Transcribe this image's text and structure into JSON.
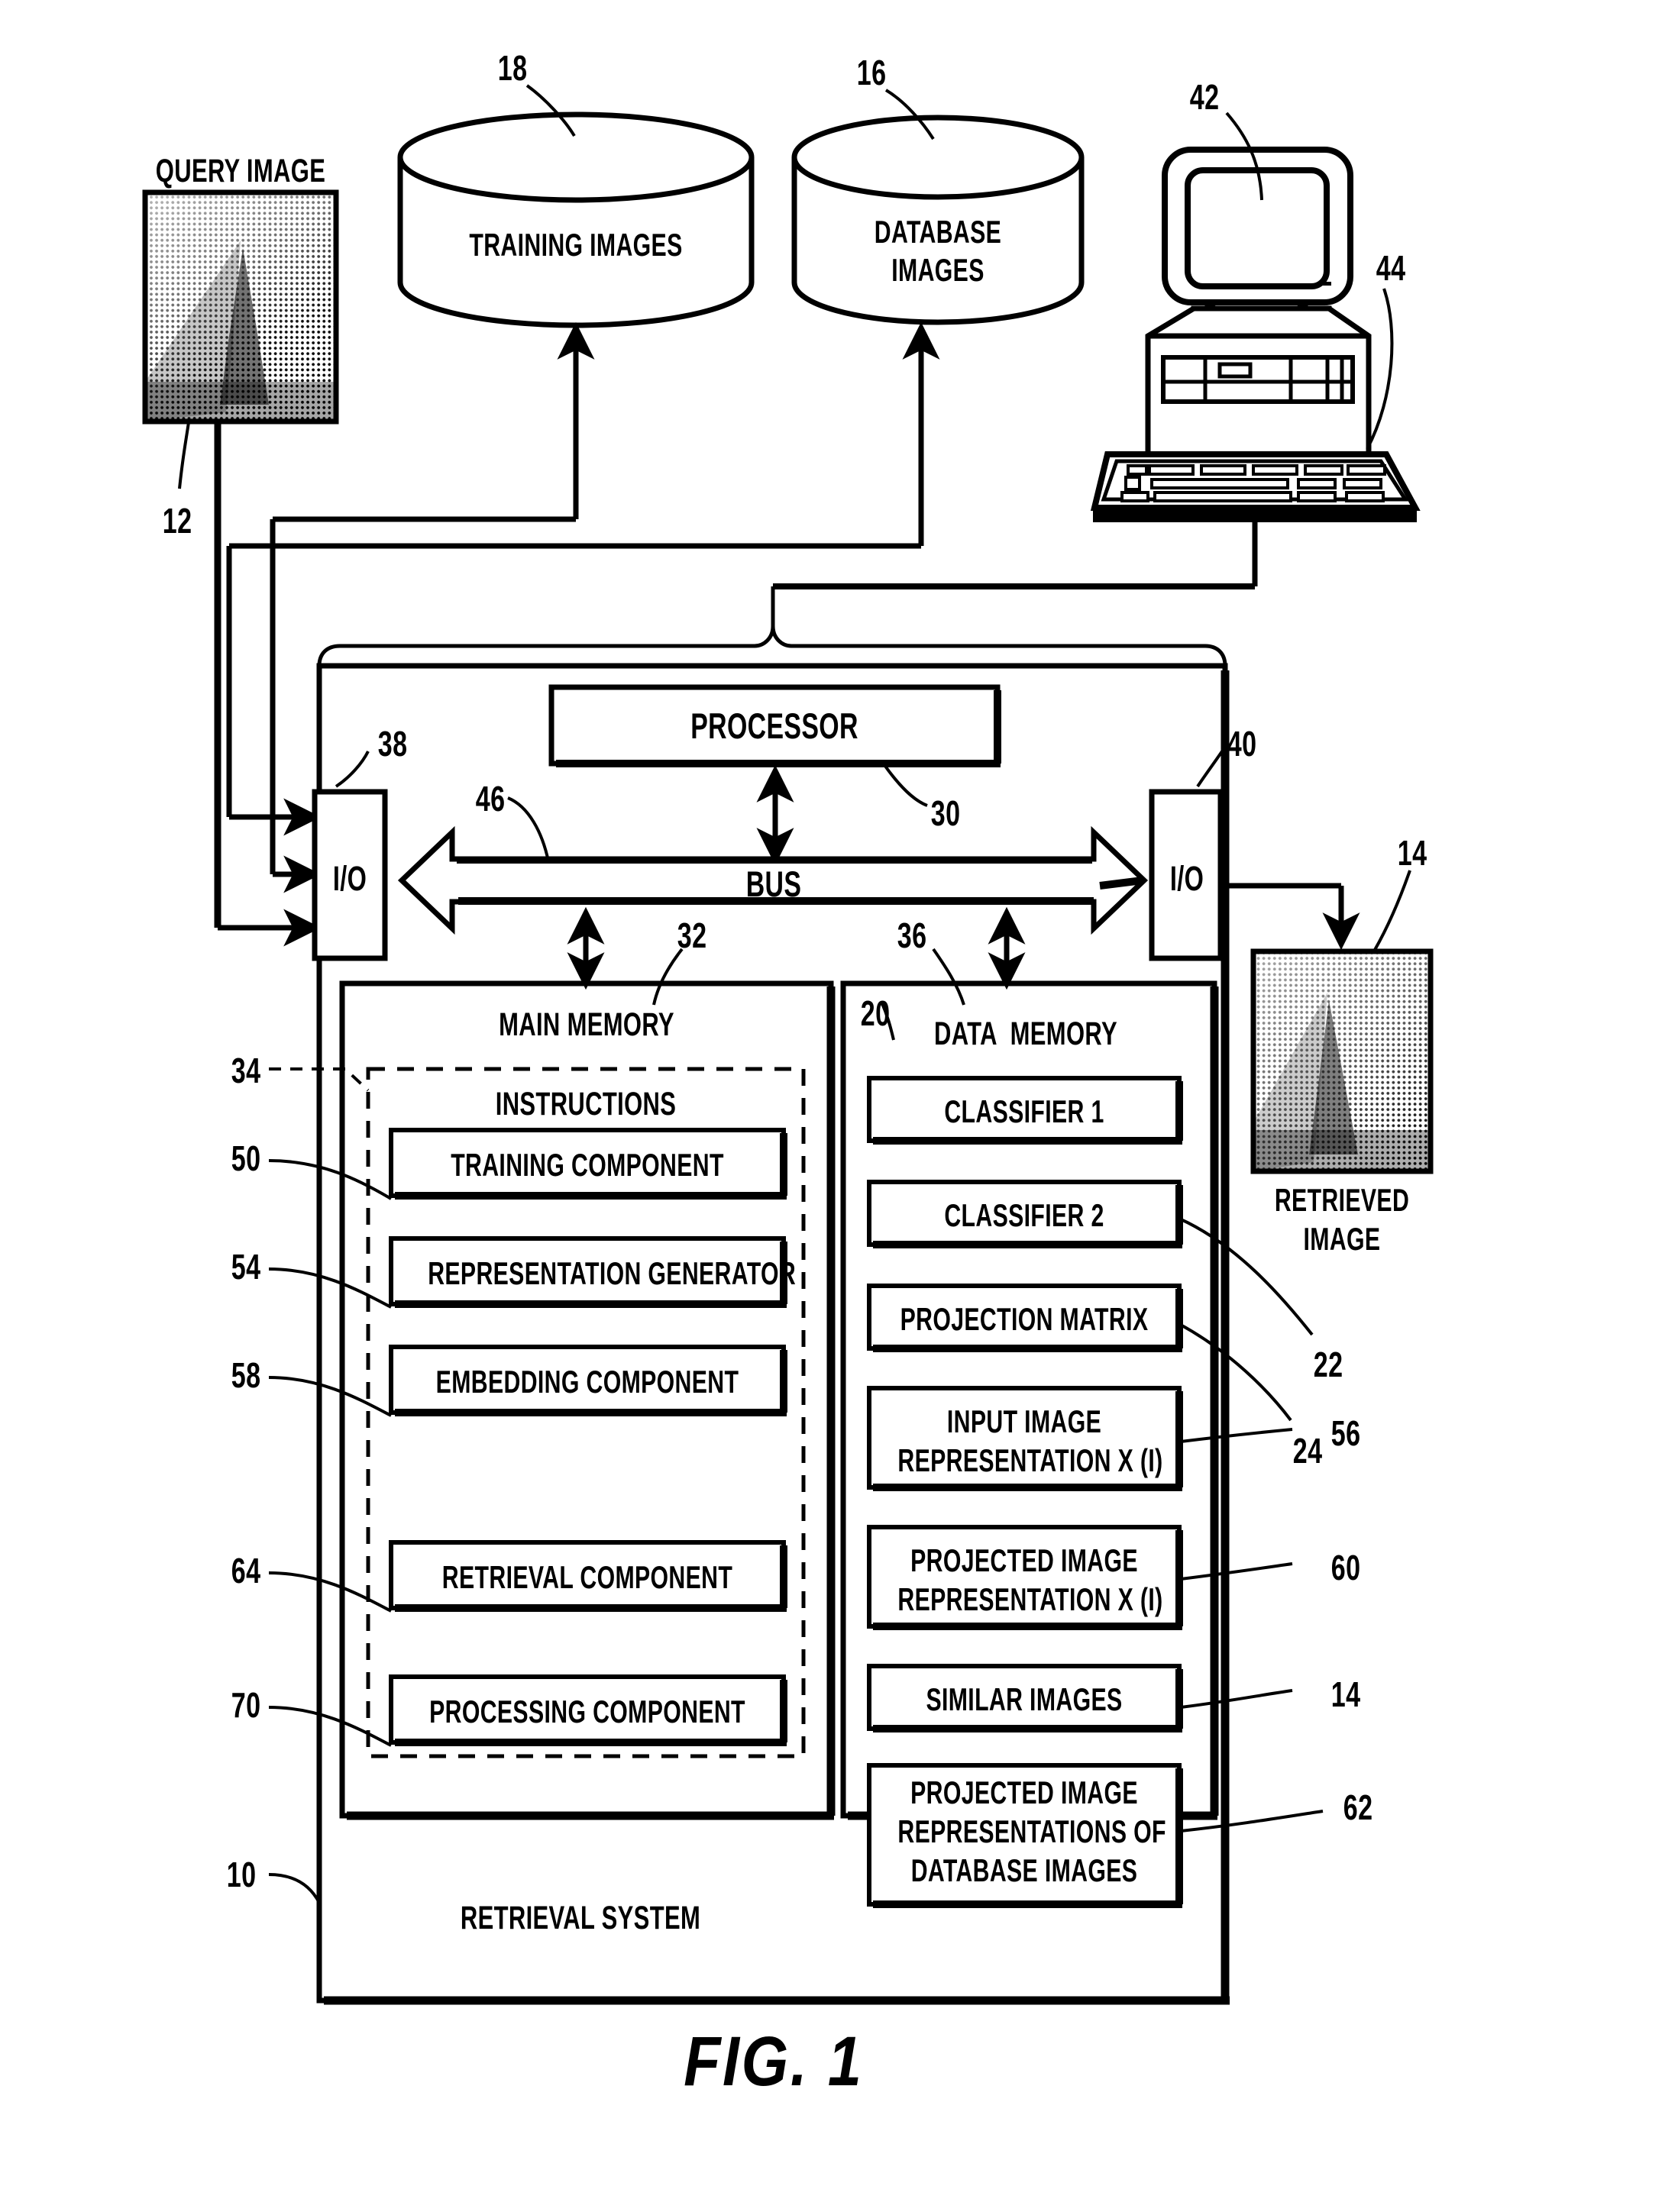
{
  "figure": {
    "caption": "FIG. 1"
  },
  "query_image": {
    "label": "QUERY IMAGE",
    "ref": "12"
  },
  "training_db": {
    "label_line1": "TRAINING IMAGES",
    "ref": "18"
  },
  "database_db": {
    "label_line1": "DATABASE",
    "label_line2": "IMAGES",
    "ref": "16"
  },
  "workstation": {
    "monitor_ref": "42",
    "keyboard_ref": "44"
  },
  "system": {
    "label": "RETRIEVAL SYSTEM",
    "ref": "10"
  },
  "processor": {
    "label": "PROCESSOR",
    "ref": "30"
  },
  "bus": {
    "label": "BUS",
    "ref": "46"
  },
  "io_left": {
    "label": "I/O",
    "ref": "38"
  },
  "io_right": {
    "label": "I/O",
    "ref": "40"
  },
  "main_memory": {
    "title": "MAIN MEMORY",
    "ref": "32",
    "instructions": {
      "title": "INSTRUCTIONS",
      "ref": "34",
      "components": [
        {
          "label": "TRAINING COMPONENT",
          "ref": "50"
        },
        {
          "label": "REPRESENTATION GENERATOR",
          "ref": "54"
        },
        {
          "label": "EMBEDDING COMPONENT",
          "ref": "58"
        },
        {
          "label": "RETRIEVAL COMPONENT",
          "ref": "64"
        },
        {
          "label": "PROCESSING COMPONENT",
          "ref": "70"
        }
      ]
    }
  },
  "data_memory": {
    "title": "DATA  MEMORY",
    "ref": "36",
    "first_item_ref": "20",
    "items": [
      {
        "line1": "CLASSIFIER 1",
        "line2": "",
        "line3": "",
        "ref": ""
      },
      {
        "line1": "CLASSIFIER 2",
        "line2": "",
        "line3": "",
        "ref": "22"
      },
      {
        "line1": "PROJECTION MATRIX",
        "line2": "",
        "line3": "",
        "ref": "24"
      },
      {
        "line1": "INPUT IMAGE",
        "line2": "REPRESENTATION X (I)",
        "line3": "",
        "ref": "56"
      },
      {
        "line1": "PROJECTED IMAGE",
        "line2": "REPRESENTATION X (I)",
        "line3": "",
        "ref": "60"
      },
      {
        "line1": "SIMILAR IMAGES",
        "line2": "",
        "line3": "",
        "ref": "14"
      },
      {
        "line1": "PROJECTED IMAGE",
        "line2": "REPRESENTATIONS OF",
        "line3": "DATABASE IMAGES",
        "ref": "62"
      }
    ]
  },
  "retrieved_image": {
    "label_line1": "RETRIEVED",
    "label_line2": "IMAGE",
    "ref": "14"
  },
  "colors": {
    "ink": "#000000",
    "paper": "#ffffff"
  }
}
